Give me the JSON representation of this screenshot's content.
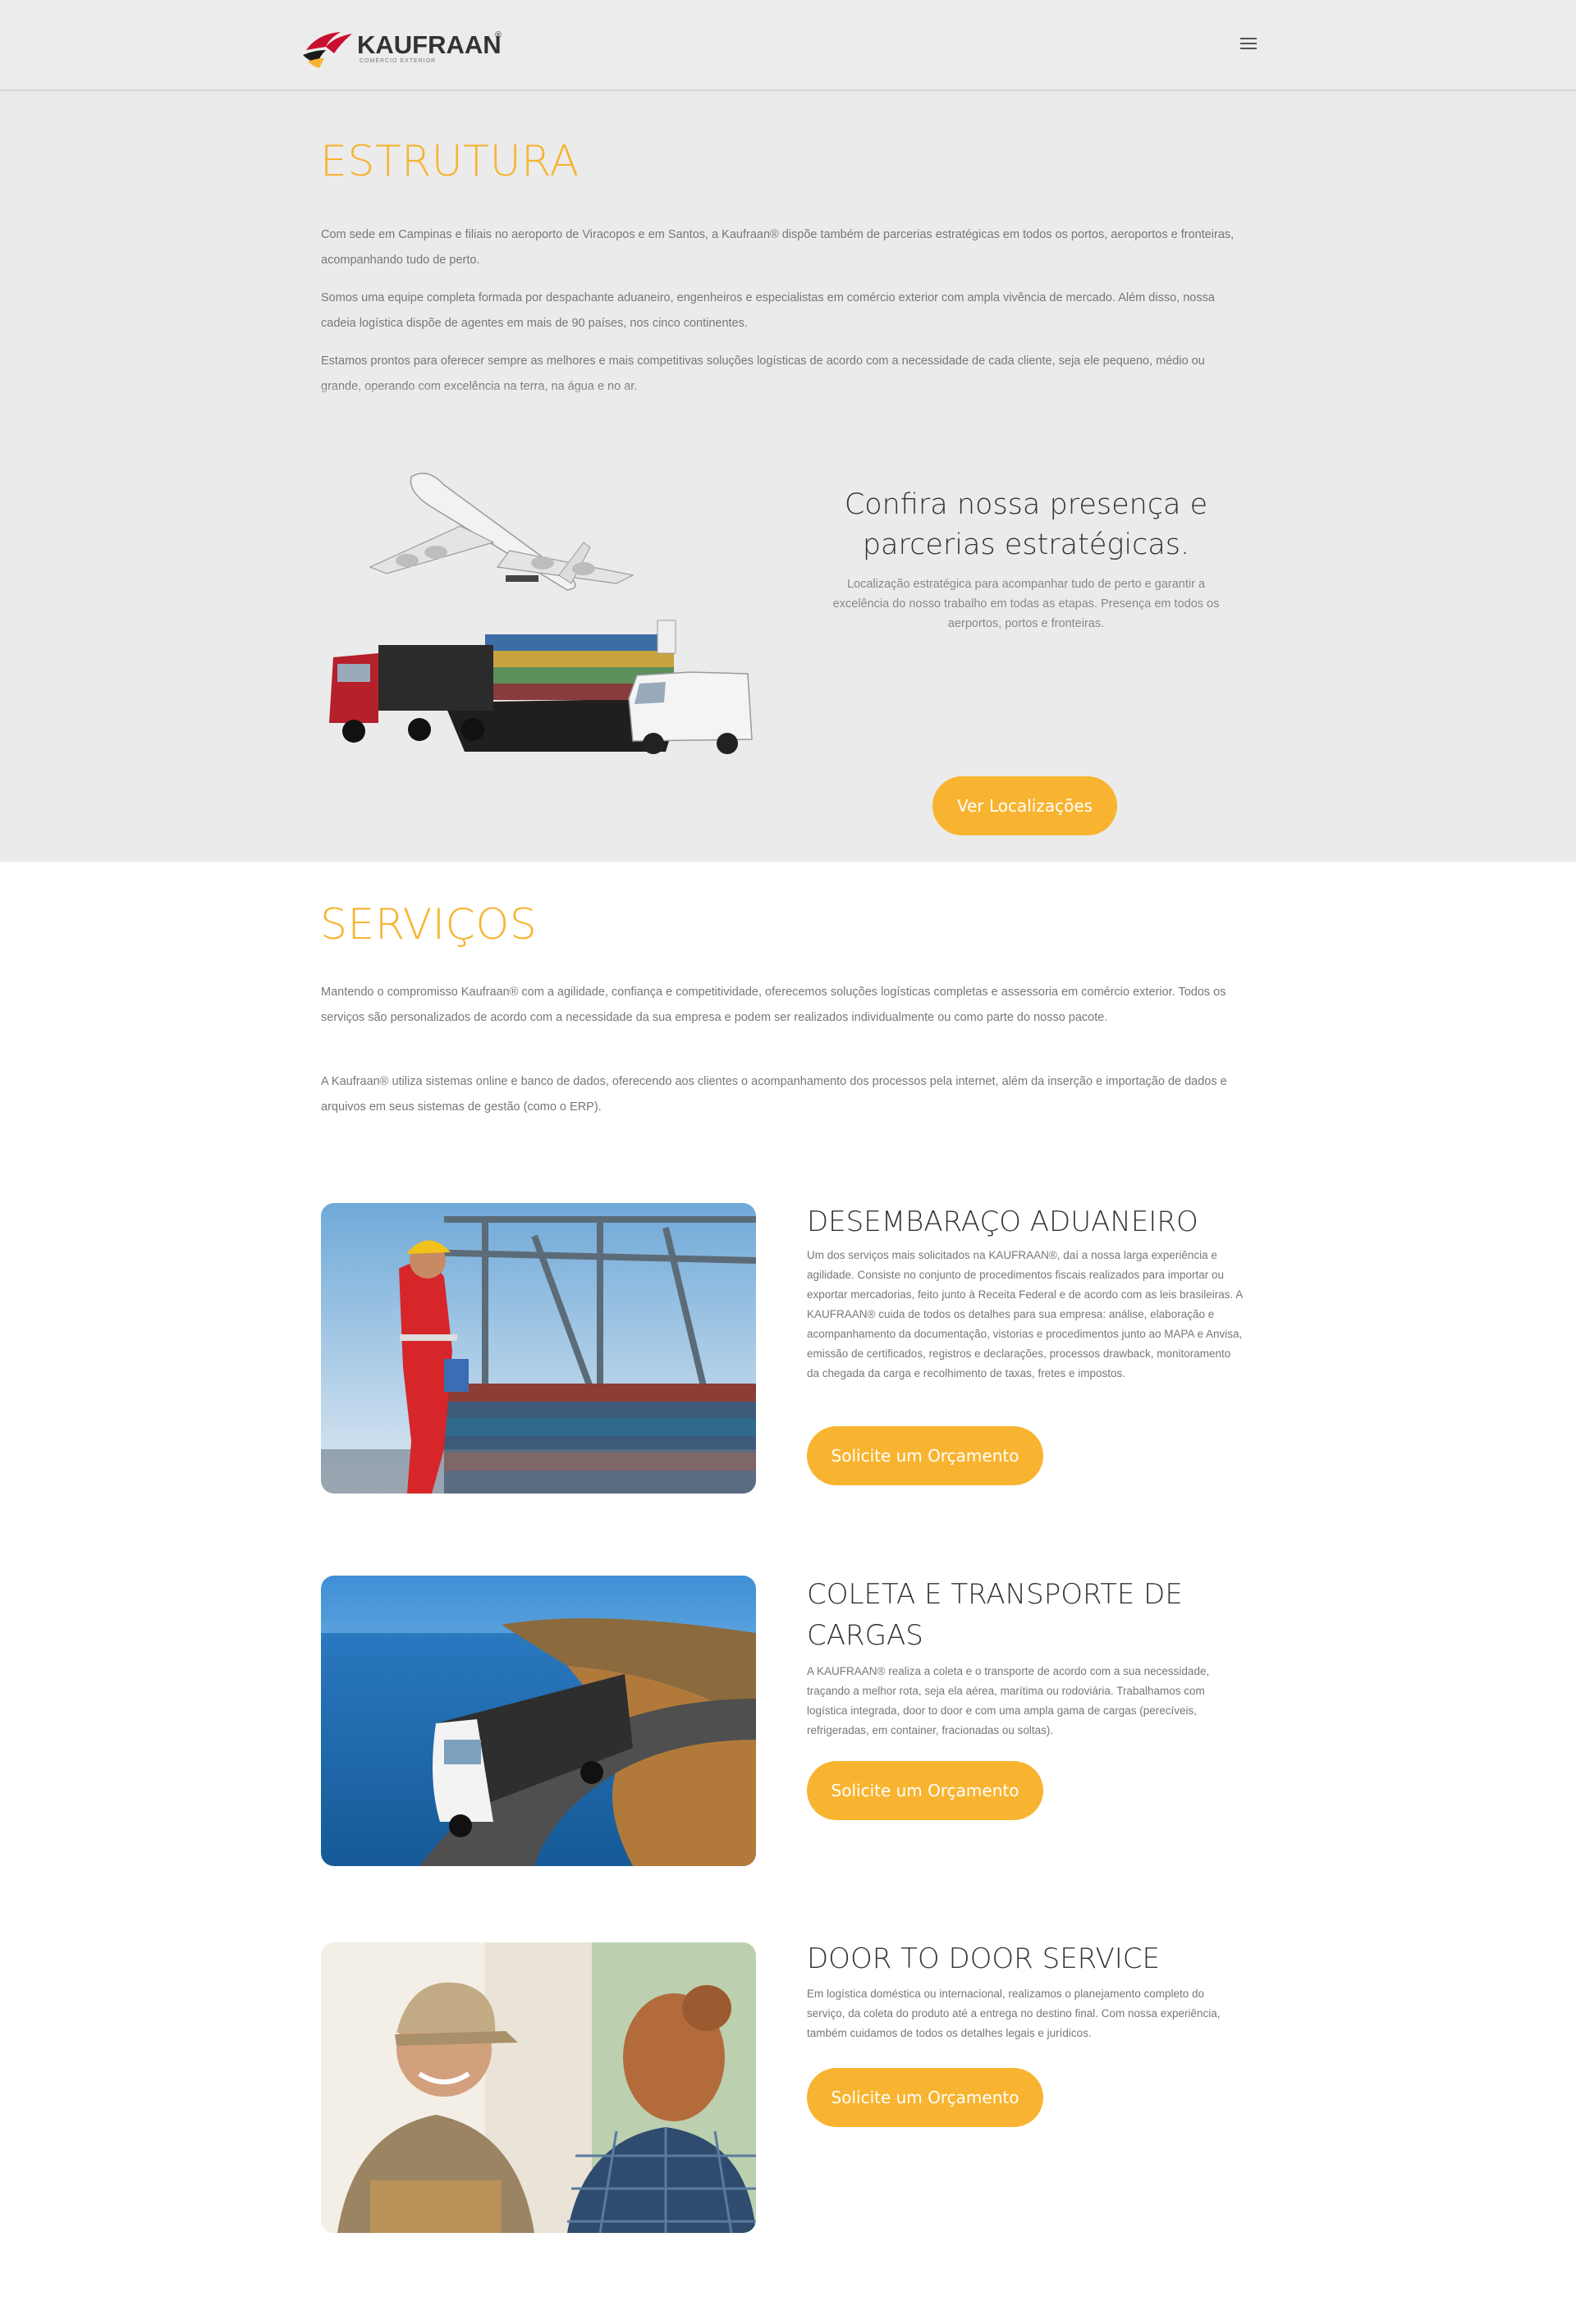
{
  "header": {
    "logo_text": "KAUFRAAN",
    "logo_reg": "®",
    "logo_sub": "Comércio Exterior",
    "menu_icon": "hamburger-menu-icon"
  },
  "estrutura": {
    "title": "ESTRUTURA",
    "paragraphs": [
      "Com sede em Campinas e filiais no aeroporto de Viracopos e em Santos, a Kaufraan® dispõe também de parcerias estratégicas em todos os portos, aeroportos e fronteiras, acompanhando tudo de perto.",
      "Somos uma equipe completa formada por despachante aduaneiro, engenheiros e especialistas em comércio exterior com ampla vivência de mercado. Além disso, nossa cadeia logística dispõe de agentes em mais de 90 países, nos cinco continentes.",
      "Estamos prontos para oferecer sempre as melhores e mais competitivas soluções logísticas de acordo com a necessidade de cada cliente, seja ele pequeno, médio ou grande, operando com excelência na terra, na água e no ar."
    ],
    "presence_title": "Confira nossa presença e parcerias estratégicas.",
    "presence_desc": "Localização estratégica para acompanhar tudo de perto e garantir a excelência do nosso trabalho em todas as etapas. Presença em todos os aerportos, portos e fronteiras.",
    "locations_button": "Ver Localizações"
  },
  "servicos": {
    "title": "SERVIÇOS",
    "paragraphs": [
      "Mantendo o compromisso Kaufraan® com a agilidade, confiança e competitividade, oferecemos soluções logísticas completas e assessoria em comércio exterior. Todos os serviços são personalizados de acordo com a necessidade da sua empresa e podem ser realizados individualmente ou como parte do nosso pacote.",
      "A Kaufraan® utiliza sistemas online e banco de dados, oferecendo aos clientes o acompanhamento dos processos pela internet, além da inserção e importação de dados e arquivos em seus sistemas de gestão (como o ERP)."
    ],
    "items": [
      {
        "title": "DESEMBARAÇO ADUANEIRO",
        "desc": "Um dos serviços mais solicitados na KAUFRAAN®, daí a nossa larga experiência e agilidade. Consiste no conjunto de procedimentos fiscais realizados para importar ou exportar mercadorias, feito junto à Receita Federal e de acordo com as leis brasileiras. A KAUFRAAN® cuida de todos os detalhes para sua empresa: análise, elaboração e acompanhamento da documentação, vistorias e procedimentos junto ao MAPA e Anvisa, emissão de certificados, registros e declarações, processos drawback, monitoramento da chegada da carga e recolhimento de taxas, fretes e impostos.",
        "button": "Solicite um Orçamento"
      },
      {
        "title": "COLETA E TRANSPORTE DE CARGAS",
        "desc": "A KAUFRAAN® realiza a coleta e o transporte de acordo com a sua necessidade, traçando a melhor rota, seja ela aérea, marítima ou rodoviária. Trabalhamos com logística integrada, door to door e com uma ampla gama de cargas (perecíveis, refrigeradas, em container, fracionadas ou soltas).",
        "button": "Solicite um Orçamento"
      },
      {
        "title": "DOOR TO DOOR SERVICE",
        "desc": "Em logística doméstica ou internacional, realizamos o planejamento completo do serviço, da coleta do produto até a entrega no destino final. Com nossa experiência, também cuidamos de todos os detalhes legais e jurídicos.",
        "button": "Solicite um Orçamento"
      }
    ]
  },
  "colors": {
    "accent": "#f8b430",
    "title_accent": "#f7b32f",
    "section_bg": "#ebebeb",
    "header_bg": "#ececec"
  }
}
